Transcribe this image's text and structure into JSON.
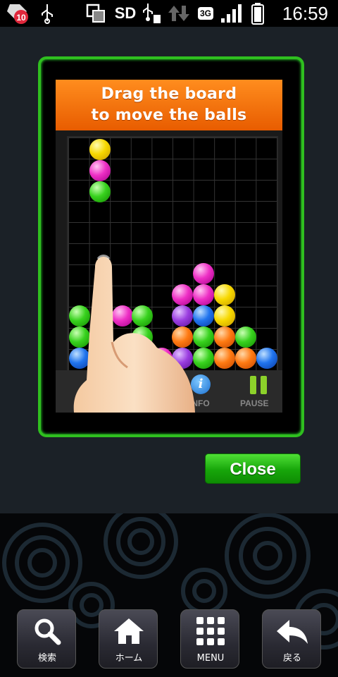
{
  "status_bar": {
    "notification_count": "10",
    "storage_label": "SD",
    "network_type": "3G",
    "time": "16:59",
    "icons": [
      "notification-badge-icon",
      "usb-icon",
      "screenshot-icon",
      "sd-icon",
      "usb-debug-icon",
      "data-transfer-icon",
      "3g-icon",
      "signal-icon",
      "battery-icon"
    ]
  },
  "tutorial": {
    "banner_line1": "Drag the board",
    "banner_line2": "to move the balls",
    "info_label": "INFO",
    "info_glyph": "i",
    "pause_label": "PAUSE",
    "frame_color": "#2fbf1f"
  },
  "dialog": {
    "close_label": "Close",
    "close_color": "#17a60a"
  },
  "dock": {
    "items": [
      {
        "label": "検索",
        "icon": "search-icon"
      },
      {
        "label": "ホーム",
        "icon": "home-icon"
      },
      {
        "label": "MENU",
        "icon": "grid-menu-icon"
      },
      {
        "label": "戻る",
        "icon": "back-arrow-icon"
      }
    ]
  }
}
